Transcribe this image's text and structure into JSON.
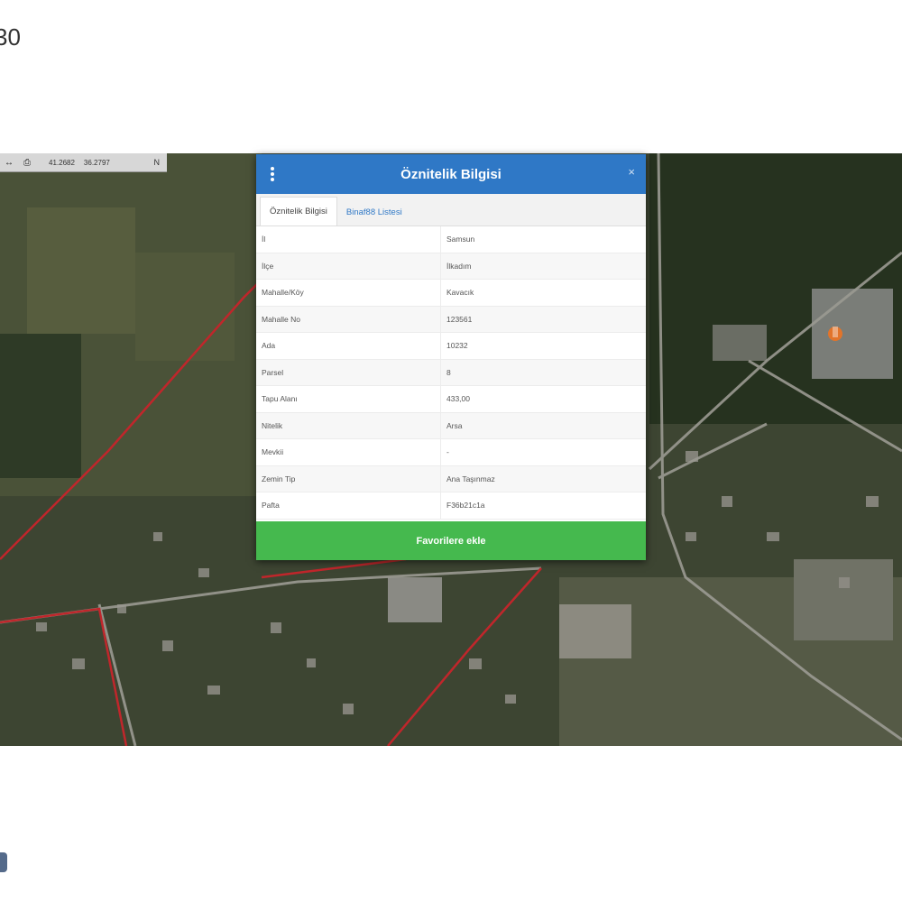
{
  "corner": {
    "number": "30"
  },
  "toolbar": {
    "back_icon": "arrow-left-icon",
    "print_icon": "printer-icon",
    "lat": "41.2682",
    "lon": "36.2797",
    "toggle_label": "N"
  },
  "dialog": {
    "title": "Öznitelik Bilgisi",
    "menu_icon": "kebab-menu-icon",
    "close_label": "×",
    "tabs": [
      {
        "label": "Öznitelik Bilgisi",
        "active": true
      },
      {
        "label": "Binaf88 Listesi",
        "active": false
      }
    ],
    "rows": [
      {
        "key": "İl",
        "value": "Samsun"
      },
      {
        "key": "İlçe",
        "value": "İlkadım"
      },
      {
        "key": "Mahalle/Köy",
        "value": "Kavacık"
      },
      {
        "key": "Mahalle No",
        "value": "123561"
      },
      {
        "key": "Ada",
        "value": "10232"
      },
      {
        "key": "Parsel",
        "value": "8"
      },
      {
        "key": "Tapu Alanı",
        "value": "433,00"
      },
      {
        "key": "Nitelik",
        "value": "Arsa"
      },
      {
        "key": "Mevkii",
        "value": "-"
      },
      {
        "key": "Zemin Tip",
        "value": "Ana Taşınmaz"
      },
      {
        "key": "Pafta",
        "value": "F36b21c1a"
      }
    ],
    "favorite_button": "Favorilere ekle"
  },
  "colors": {
    "header_blue": "#2f78c6",
    "button_green": "#45b94e",
    "parcel_line_red": "#c0262b"
  }
}
